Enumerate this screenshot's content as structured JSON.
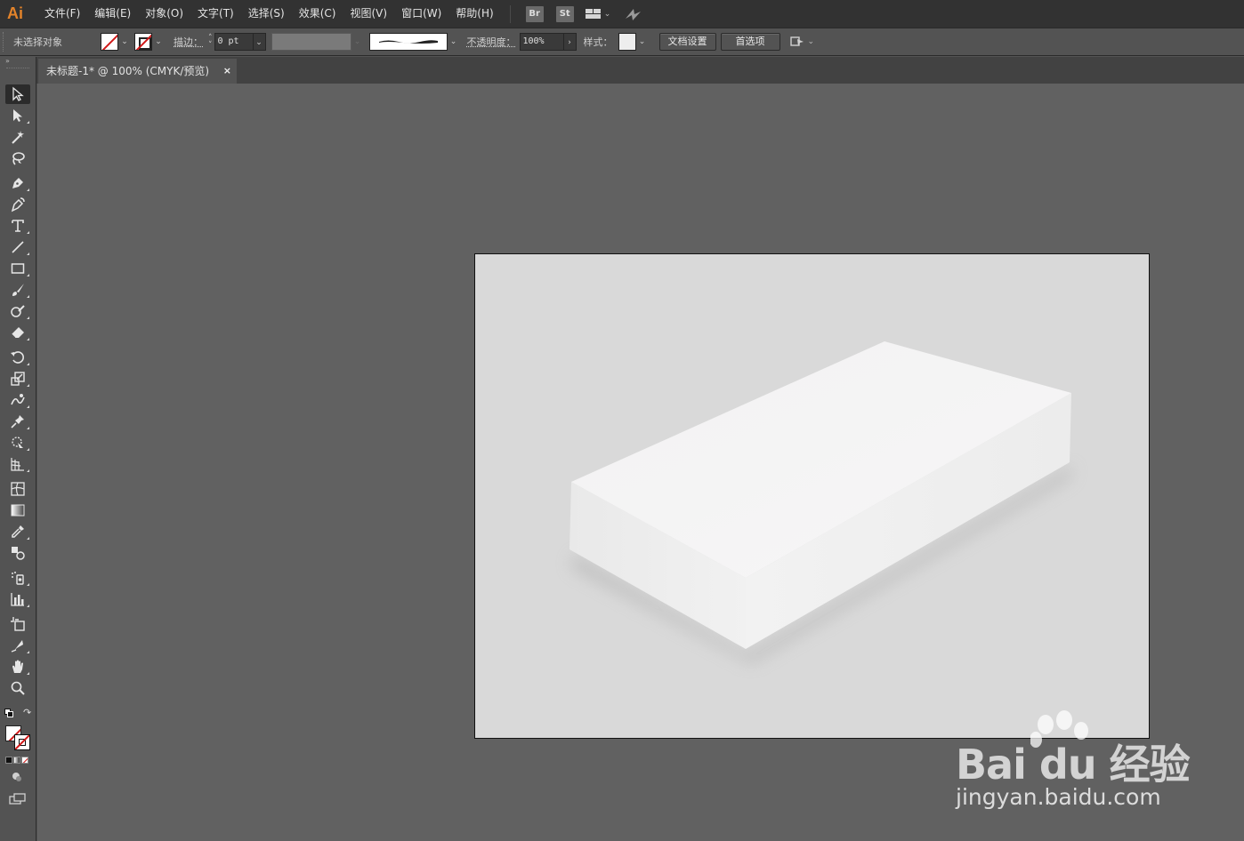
{
  "app": {
    "logo": "Ai",
    "accent": "#e3832a"
  },
  "menu": {
    "items": [
      "文件(F)",
      "编辑(E)",
      "对象(O)",
      "文字(T)",
      "选择(S)",
      "效果(C)",
      "视图(V)",
      "窗口(W)",
      "帮助(H)"
    ],
    "bridge_label": "Br",
    "stock_label": "St"
  },
  "control": {
    "selection_status": "未选择对象",
    "stroke_label": "描边：",
    "stroke_weight": "0 pt",
    "opacity_label": "不透明度：",
    "opacity_value": "100%",
    "style_label": "样式：",
    "doc_setup_button": "文档设置",
    "prefs_button": "首选项"
  },
  "document": {
    "tab_title": "未标题-1* @ 100% (CMYK/预览)",
    "close_glyph": "×"
  },
  "toolbox": {
    "tools": [
      "selection-tool",
      "direct-selection-tool",
      "magic-wand-tool",
      "lasso-tool",
      "pen-tool",
      "curvature-tool",
      "type-tool",
      "line-segment-tool",
      "rectangle-tool",
      "paintbrush-tool",
      "shaper-tool",
      "eraser-tool",
      "rotate-tool",
      "scale-tool",
      "warp-tool",
      "puppet-warp-tool",
      "free-transform-tool",
      "perspective-grid-tool",
      "mesh-tool",
      "gradient-tool",
      "eyedropper-tool",
      "blend-tool",
      "symbol-sprayer-tool",
      "column-graph-tool",
      "artboard-tool",
      "slice-tool",
      "hand-tool",
      "zoom-tool"
    ],
    "active_tool": "selection-tool"
  },
  "canvas": {
    "artboard_color": "#d9d9d9",
    "object": "3d-white-box"
  },
  "watermark": {
    "logo_text": "Bai du 经验",
    "url": "jingyan.baidu.com"
  }
}
